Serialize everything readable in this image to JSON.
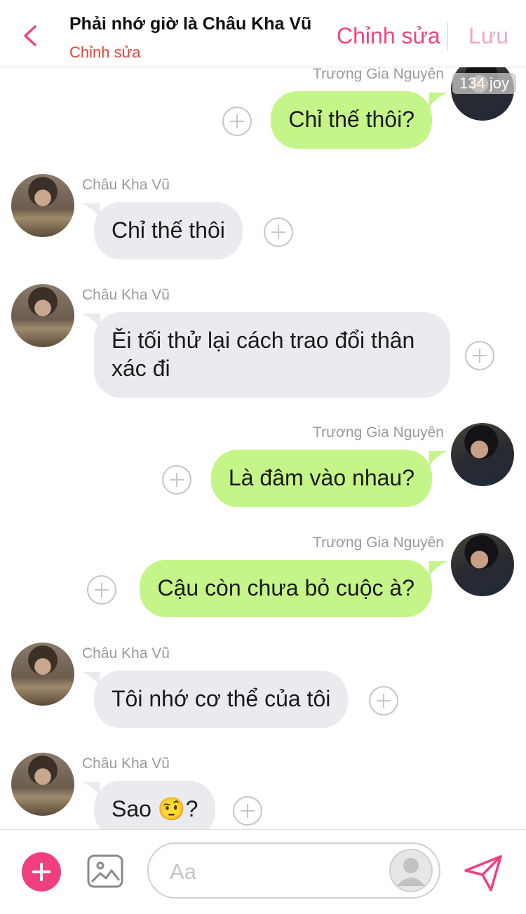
{
  "header": {
    "title": "Phải nhớ giờ là Châu Kha Vũ",
    "subtitle": "Chỉnh sửa",
    "edit_label": "Chỉnh sửa",
    "save_label": "Lưu"
  },
  "messages": [
    {
      "sender": "Trương Gia Nguyên",
      "text": "Chỉ thế thôi?",
      "side": "right",
      "badge": "134 joy"
    },
    {
      "sender": "Châu Kha Vũ",
      "text": "Chỉ thế thôi",
      "side": "left"
    },
    {
      "sender": "Châu Kha Vũ",
      "text": "Ěi tối thử lại cách trao đổi thân xác đi",
      "side": "left"
    },
    {
      "sender": "Trương Gia Nguyên",
      "text": "Là đâm vào nhau?",
      "side": "right"
    },
    {
      "sender": "Trương Gia Nguyên",
      "text": "Cậu còn chưa bỏ cuộc à?",
      "side": "right"
    },
    {
      "sender": "Châu Kha Vũ",
      "text": "Tôi nhớ cơ thể của tôi",
      "side": "left"
    },
    {
      "sender": "Châu Kha Vũ",
      "text": "Sao 🤨?",
      "side": "left"
    }
  ],
  "composer": {
    "placeholder": "Aa"
  },
  "colors": {
    "accent": "#ef3f80",
    "incoming_bubble": "#e9ebef",
    "outgoing_bubble": "#c5f588",
    "subtitle": "#e0443a"
  },
  "icons": {
    "back": "chevron-left-icon",
    "add": "plus-icon",
    "image": "image-icon",
    "profile": "user-icon",
    "send": "send-icon"
  }
}
